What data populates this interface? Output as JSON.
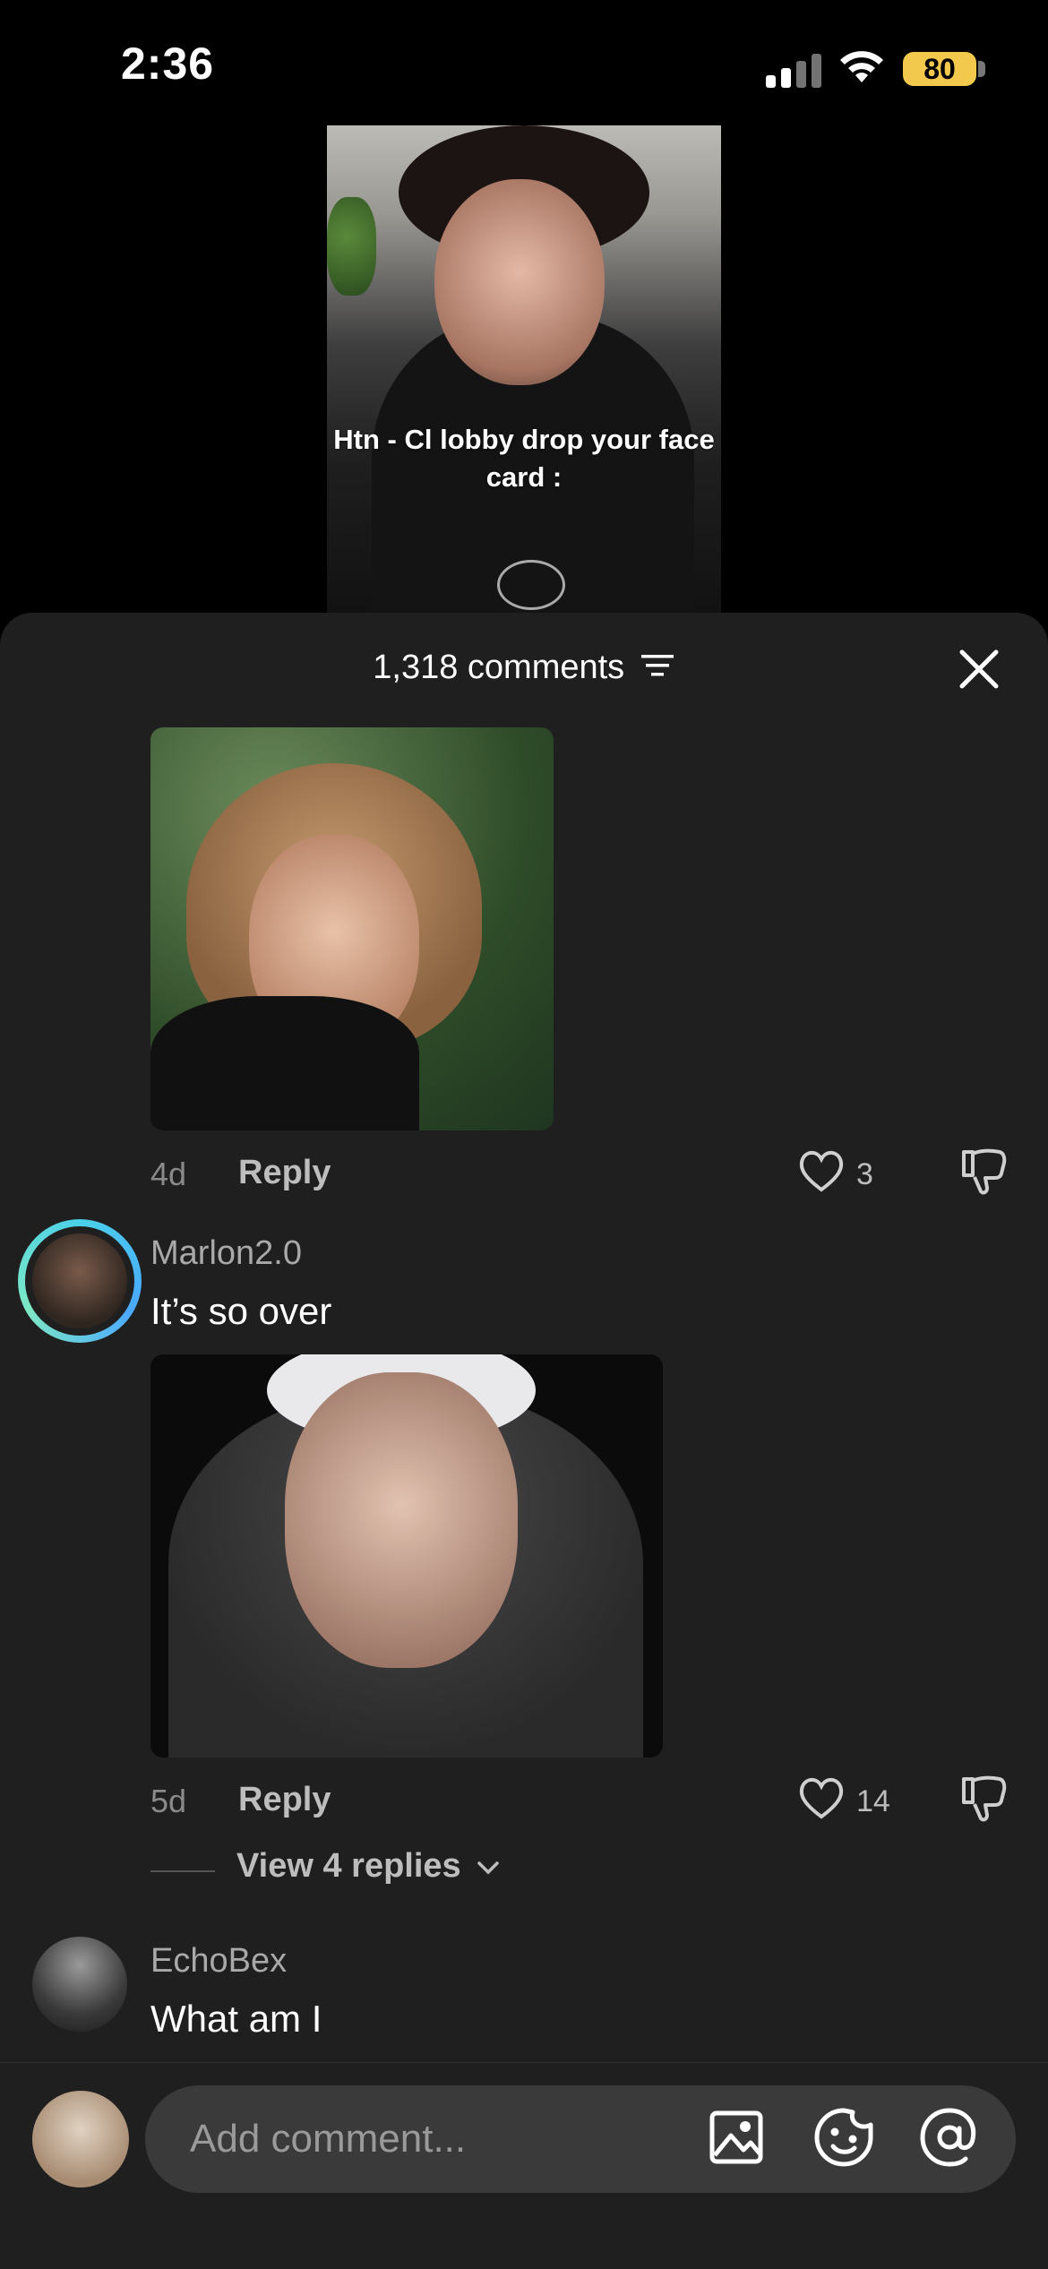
{
  "status_bar": {
    "time": "2:36",
    "battery": "80"
  },
  "video": {
    "caption": "Htn - Cl lobby drop your face card :"
  },
  "sheet": {
    "title": "1,318 comments"
  },
  "comments": [
    {
      "time": "4d",
      "reply_label": "Reply",
      "likes": "3"
    },
    {
      "username": "Marlon2.0",
      "text": "It’s so over",
      "time": "5d",
      "reply_label": "Reply",
      "likes": "14",
      "view_replies": "View 4 replies"
    },
    {
      "username": "EchoBex",
      "text": "What am I"
    }
  ],
  "composer": {
    "placeholder": "Add comment..."
  }
}
